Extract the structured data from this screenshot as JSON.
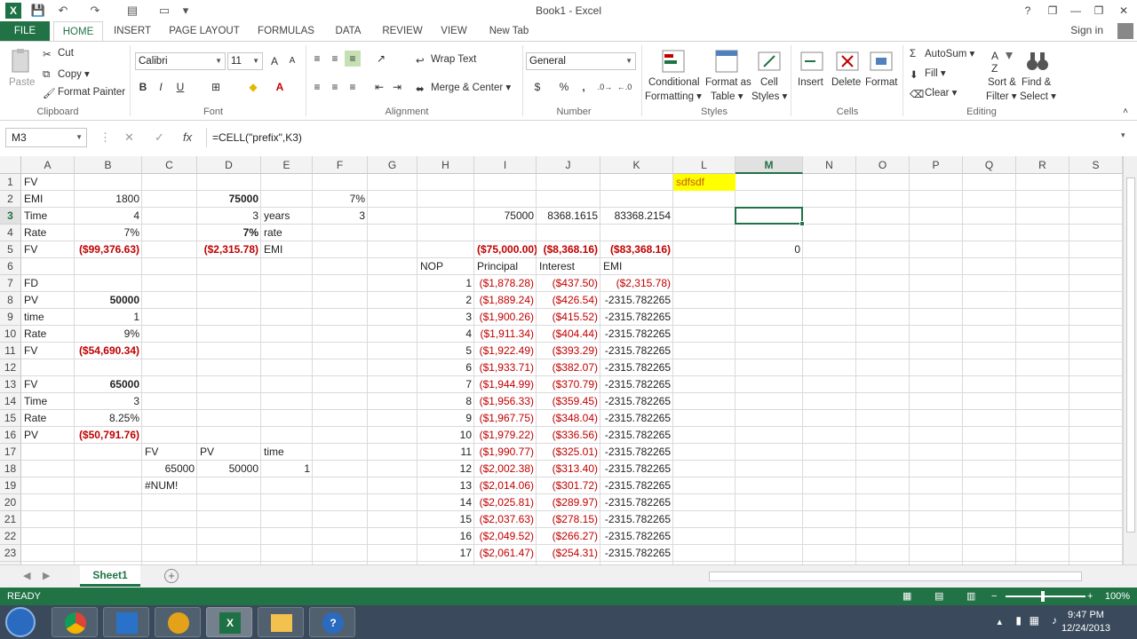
{
  "window": {
    "title": "Book1 - Excel",
    "help": "?",
    "restore": "❐",
    "minimize": "—",
    "maximize": "❐",
    "close": "✕"
  },
  "ribbon_tabs": [
    "FILE",
    "HOME",
    "INSERT",
    "PAGE LAYOUT",
    "FORMULAS",
    "DATA",
    "REVIEW",
    "VIEW",
    "New Tab"
  ],
  "signin": "Sign in",
  "clipboard": {
    "paste": "Paste",
    "cut": "Cut",
    "copy": "Copy",
    "format_painter": "Format Painter",
    "group": "Clipboard"
  },
  "font": {
    "name": "Calibri",
    "size": "11",
    "bold": "B",
    "italic": "I",
    "underline": "U",
    "grow": "A",
    "shrink": "A",
    "group": "Font"
  },
  "alignment": {
    "wrap_text": "Wrap Text",
    "merge_center": "Merge & Center",
    "group": "Alignment"
  },
  "number": {
    "format": "General",
    "currency": "$",
    "percent": "%",
    "comma": ",",
    "group": "Number"
  },
  "styles": {
    "conditional": "Conditional",
    "conditional2": "Formatting",
    "format_table": "Format as",
    "format_table2": "Table",
    "cell_styles": "Cell",
    "cell_styles2": "Styles",
    "group": "Styles"
  },
  "cells": {
    "insert": "Insert",
    "delete": "Delete",
    "format": "Format",
    "group": "Cells"
  },
  "editing": {
    "autosum": "AutoSum",
    "fill": "Fill",
    "clear": "Clear",
    "sort": "Sort &",
    "sort2": "Filter",
    "find": "Find &",
    "find2": "Select",
    "group": "Editing"
  },
  "formula_bar": {
    "name_box": "M3",
    "fx": "fx",
    "formula": "=CELL(\"prefix\",K3)"
  },
  "columns": [
    "A",
    "B",
    "C",
    "D",
    "E",
    "F",
    "G",
    "H",
    "I",
    "J",
    "K",
    "L",
    "M",
    "N",
    "O",
    "P",
    "Q",
    "R",
    "S"
  ],
  "rows": [
    "1",
    "2",
    "3",
    "4",
    "5",
    "6",
    "7",
    "8",
    "9",
    "10",
    "11",
    "12",
    "13",
    "14",
    "15",
    "16",
    "17",
    "18",
    "19",
    "20",
    "21",
    "22",
    "23",
    "24"
  ],
  "cells_data": {
    "A1": "FV",
    "A2": "EMI",
    "B2": "1800",
    "D2": "75000",
    "F2": "7%",
    "A3": "Time",
    "B3": "4",
    "D3": "3",
    "E3": "years",
    "F3": "3",
    "I3": "75000",
    "J3": "8368.1615",
    "K3": "83368.2154",
    "A4": "Rate",
    "B4": "7%",
    "D4": "7%",
    "E4": "rate",
    "A5": "FV",
    "B5": "($99,376.63)",
    "D5": "($2,315.78)",
    "E5": "EMI",
    "I5": "($75,000.00)",
    "J5": "($8,368.16)",
    "K5": "($83,368.16)",
    "M5": "0",
    "H6": "NOP",
    "I6": "Principal",
    "J6": "Interest",
    "K6": "EMI",
    "A7": "FD",
    "A8": "PV",
    "B8": "50000",
    "A9": "time",
    "B9": "1",
    "A10": "Rate",
    "B10": "9%",
    "A11": "FV",
    "B11": "($54,690.34)",
    "A13": "FV",
    "B13": "65000",
    "A14": "Time",
    "B14": "3",
    "A15": "Rate",
    "B15": "8.25%",
    "A16": "PV",
    "B16": "($50,791.76)",
    "C17": "FV",
    "D17": "PV",
    "E17": "time",
    "C18": "65000",
    "D18": "50000",
    "E18": "1",
    "C19": "#NUM!",
    "L1": "sdfsdf"
  },
  "schedule": [
    {
      "nop": "1",
      "principal": "($1,878.28)",
      "interest": "($437.50)",
      "emi": "($2,315.78)"
    },
    {
      "nop": "2",
      "principal": "($1,889.24)",
      "interest": "($426.54)",
      "emi": "-2315.782265"
    },
    {
      "nop": "3",
      "principal": "($1,900.26)",
      "interest": "($415.52)",
      "emi": "-2315.782265"
    },
    {
      "nop": "4",
      "principal": "($1,911.34)",
      "interest": "($404.44)",
      "emi": "-2315.782265"
    },
    {
      "nop": "5",
      "principal": "($1,922.49)",
      "interest": "($393.29)",
      "emi": "-2315.782265"
    },
    {
      "nop": "6",
      "principal": "($1,933.71)",
      "interest": "($382.07)",
      "emi": "-2315.782265"
    },
    {
      "nop": "7",
      "principal": "($1,944.99)",
      "interest": "($370.79)",
      "emi": "-2315.782265"
    },
    {
      "nop": "8",
      "principal": "($1,956.33)",
      "interest": "($359.45)",
      "emi": "-2315.782265"
    },
    {
      "nop": "9",
      "principal": "($1,967.75)",
      "interest": "($348.04)",
      "emi": "-2315.782265"
    },
    {
      "nop": "10",
      "principal": "($1,979.22)",
      "interest": "($336.56)",
      "emi": "-2315.782265"
    },
    {
      "nop": "11",
      "principal": "($1,990.77)",
      "interest": "($325.01)",
      "emi": "-2315.782265"
    },
    {
      "nop": "12",
      "principal": "($2,002.38)",
      "interest": "($313.40)",
      "emi": "-2315.782265"
    },
    {
      "nop": "13",
      "principal": "($2,014.06)",
      "interest": "($301.72)",
      "emi": "-2315.782265"
    },
    {
      "nop": "14",
      "principal": "($2,025.81)",
      "interest": "($289.97)",
      "emi": "-2315.782265"
    },
    {
      "nop": "15",
      "principal": "($2,037.63)",
      "interest": "($278.15)",
      "emi": "-2315.782265"
    },
    {
      "nop": "16",
      "principal": "($2,049.52)",
      "interest": "($266.27)",
      "emi": "-2315.782265"
    },
    {
      "nop": "17",
      "principal": "($2,061.47)",
      "interest": "($254.31)",
      "emi": "-2315.782265"
    }
  ],
  "sheet_tab": "Sheet1",
  "status": {
    "ready": "READY",
    "zoom": "100%"
  },
  "clock": {
    "time": "9:47 PM",
    "date": "12/24/2013"
  },
  "colors": {
    "excel_green": "#217346",
    "negative_red": "#c00000",
    "highlight_yellow": "#ffff00"
  }
}
